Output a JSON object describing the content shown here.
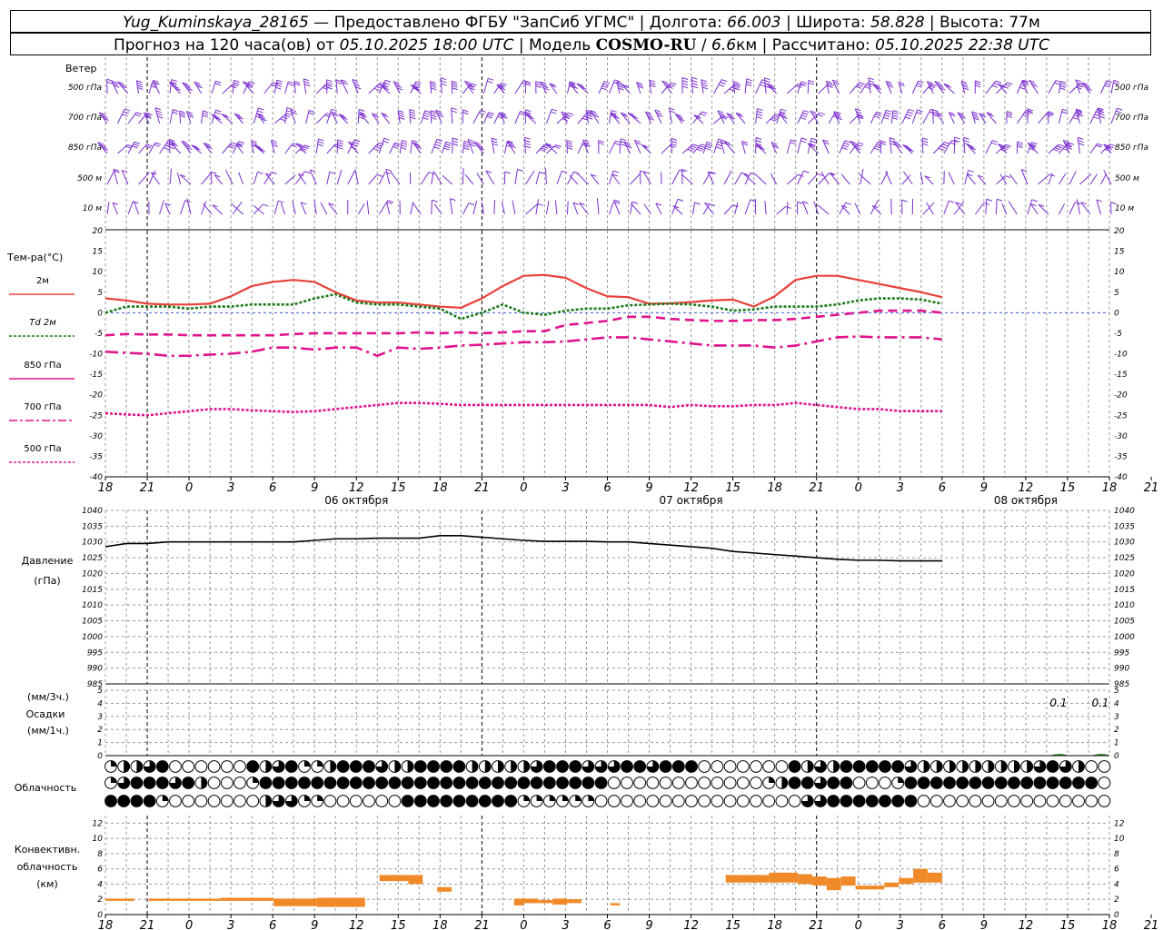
{
  "header": {
    "row1": [
      {
        "t": "Yug_Kuminskaya_28165",
        "italic": true
      },
      {
        "t": " — Предоставлено ФГБУ \"ЗапСиб УГМС\" | Долгота: "
      },
      {
        "t": "66.003",
        "italic": true
      },
      {
        "t": " | Широта: "
      },
      {
        "t": "58.828",
        "italic": true
      },
      {
        "t": " | Высота: "
      },
      {
        "t": "77м",
        "italic": false
      }
    ],
    "row2": [
      {
        "t": "Прогноз на 120 часа(ов) от "
      },
      {
        "t": "05.10.2025 18:00 UTC",
        "italic": true
      },
      {
        "t": "  | Модель "
      },
      {
        "t": "COSMO-RU",
        "bold": true
      },
      {
        "t": " / "
      },
      {
        "t": "6.6",
        "italic": true
      },
      {
        "t": "км | Рассчитано: "
      },
      {
        "t": "05.10.2025 22:38 UTC",
        "italic": true
      }
    ]
  },
  "x_axis": {
    "hour_labels": [
      "18",
      "21",
      "0",
      "3",
      "6",
      "9",
      "12",
      "15",
      "18",
      "21",
      "0",
      "3",
      "6",
      "9",
      "12",
      "15",
      "18",
      "21",
      "0",
      "3",
      "6",
      "9",
      "12",
      "15",
      "18",
      "21",
      "0"
    ],
    "day_labels": [
      "06 октября",
      "07 октября",
      "08 октября"
    ]
  },
  "wind_panel": {
    "title": "Ветер",
    "levels": [
      "500 гПа",
      "700 гПа",
      "850 гПа",
      "500 м",
      "10 м"
    ],
    "color": "#7b2fd0"
  },
  "temp_panel": {
    "title": "Тем-ра(°C)",
    "legend": [
      {
        "label": "2м",
        "color": "#e8403a",
        "dash": "solid"
      },
      {
        "label": "Td 2м",
        "color": "#1a7a1a",
        "dash": "dot"
      },
      {
        "label": "850 гПа",
        "color": "#e0138c",
        "dash": "solid"
      },
      {
        "label": "700 гПа",
        "color": "#e0138c",
        "dash": "dashdot"
      },
      {
        "label": "500 гПа",
        "color": "#e0138c",
        "dash": "dot"
      }
    ],
    "y_ticks": [
      "20",
      "15",
      "10",
      "5",
      "0",
      "-5",
      "-10",
      "-15",
      "-20",
      "-25",
      "-30",
      "-35",
      "-40"
    ]
  },
  "pressure_panel": {
    "title1": "Давление",
    "title2": "(гПа)",
    "y_ticks": [
      "1040",
      "1035",
      "1030",
      "1025",
      "1020",
      "1015",
      "1010",
      "1005",
      "1000",
      "995",
      "990",
      "985"
    ]
  },
  "precip_panel": {
    "title1": "(мм/3ч.)",
    "title2": "Осадки",
    "title3": "(мм/1ч.)",
    "y_ticks": [
      "5",
      "4",
      "3",
      "2",
      "1",
      "0"
    ],
    "annotations": [
      "0.1",
      "0.1"
    ]
  },
  "cloud_panel": {
    "title": "Облачность"
  },
  "conv_panel": {
    "title1": "Конвективн.",
    "title2": "облачность",
    "title3": "(км)",
    "y_ticks": [
      "12",
      "10",
      "8",
      "6",
      "4",
      "2",
      "0"
    ],
    "color": "#f08a28"
  },
  "chart_data": [
    {
      "type": "line",
      "title": "Тем-ра(°C)",
      "x_hours": [
        0,
        3,
        6,
        9,
        12,
        15,
        18,
        21,
        24,
        27,
        30,
        33,
        36,
        39,
        42,
        45,
        48,
        51,
        54,
        57,
        60,
        63,
        66,
        69,
        72,
        75,
        78,
        81,
        84,
        87,
        90,
        93,
        96,
        99,
        102,
        105,
        108,
        111,
        114,
        117,
        120
      ],
      "ylim": [
        -40,
        20
      ],
      "series": [
        {
          "name": "2м",
          "values": [
            3.5,
            3,
            2.2,
            2,
            2,
            2.2,
            4,
            6.5,
            7.5,
            8,
            7.5,
            5,
            3,
            2.5,
            2.5,
            2,
            1.5,
            1.2,
            3.5,
            6.5,
            9,
            9.2,
            8.5,
            6,
            4,
            3.8,
            2.2,
            2.3,
            2.6,
            3,
            3.2,
            1.5,
            4,
            8,
            9,
            9,
            8,
            7,
            6,
            5,
            3.8
          ]
        },
        {
          "name": "Td 2м",
          "values": [
            0,
            1.5,
            1.5,
            1.5,
            1,
            1.5,
            1.5,
            2,
            2,
            2,
            3.5,
            4.5,
            2.5,
            2,
            2,
            1.5,
            1,
            -1.5,
            0,
            2,
            0,
            -0.5,
            0.5,
            1,
            1,
            1.8,
            2,
            2.2,
            2,
            1.5,
            0.5,
            0.8,
            1.5,
            1.5,
            1.5,
            2,
            3,
            3.5,
            3.5,
            3.2,
            2.2
          ]
        },
        {
          "name": "850 гПа",
          "values": [
            -5.5,
            -5.2,
            -5.3,
            -5.3,
            -5.5,
            -5.5,
            -5.5,
            -5.5,
            -5.5,
            -5.2,
            -5,
            -5,
            -5,
            -5,
            -5,
            -4.8,
            -5,
            -4.8,
            -5,
            -4.8,
            -4.5,
            -4.5,
            -3,
            -2.5,
            -2,
            -1,
            -1,
            -1.5,
            -1.8,
            -2,
            -2,
            -1.8,
            -1.8,
            -1.5,
            -1,
            -0.5,
            0,
            0.5,
            0.5,
            0.5,
            0
          ]
        },
        {
          "name": "700 гПа",
          "values": [
            -9.5,
            -9.8,
            -10,
            -10.5,
            -10.5,
            -10.2,
            -10,
            -9.5,
            -8.5,
            -8.5,
            -9,
            -8.5,
            -8.5,
            -10.5,
            -8.5,
            -8.8,
            -8.5,
            -8,
            -7.8,
            -7.5,
            -7.2,
            -7.2,
            -7,
            -6.5,
            -6,
            -6,
            -6.5,
            -7,
            -7.5,
            -8,
            -8,
            -8,
            -8.5,
            -8,
            -7,
            -6,
            -5.8,
            -6,
            -6,
            -6,
            -6.5
          ]
        },
        {
          "name": "500 гПа",
          "values": [
            -24.5,
            -24.8,
            -25,
            -24.5,
            -24,
            -23.5,
            -23.5,
            -23.8,
            -24,
            -24.2,
            -24,
            -23.5,
            -23,
            -22.5,
            -22,
            -22,
            -22.2,
            -22.5,
            -22.5,
            -22.5,
            -22.5,
            -22.5,
            -22.5,
            -22.5,
            -22.5,
            -22.5,
            -22.5,
            -23,
            -22.5,
            -22.8,
            -22.8,
            -22.5,
            -22.5,
            -22,
            -22.5,
            -23,
            -23.5,
            -23.5,
            -24,
            -24,
            -24
          ]
        }
      ]
    },
    {
      "type": "line",
      "title": "Давление",
      "x_hours": [
        0,
        3,
        6,
        9,
        12,
        15,
        18,
        21,
        24,
        27,
        30,
        33,
        36,
        39,
        42,
        45,
        48,
        51,
        54,
        57,
        60,
        63,
        66,
        69,
        72,
        75,
        78,
        81,
        84,
        87,
        90,
        93,
        96,
        99,
        102,
        105,
        108,
        111,
        114,
        117,
        120
      ],
      "ylim": [
        985,
        1040
      ],
      "series": [
        {
          "name": "",
          "values": [
            1028.5,
            1029.5,
            1029.5,
            1030,
            1030,
            1030,
            1030,
            1030,
            1030,
            1030,
            1030.5,
            1031,
            1031,
            1031.2,
            1031.2,
            1031.2,
            1032,
            1032,
            1031.5,
            1031,
            1030.5,
            1030.2,
            1030.2,
            1030.2,
            1030,
            1030,
            1029.5,
            1029,
            1028.5,
            1028,
            1027,
            1026.5,
            1026,
            1025.5,
            1025,
            1024.5,
            1024.2,
            1024.2,
            1024,
            1024,
            1024
          ]
        }
      ]
    },
    {
      "type": "bar",
      "title": "Осадки",
      "ylim": [
        0,
        5
      ],
      "x_hours": [
        114,
        120
      ],
      "values": [
        0.1,
        0.1
      ]
    },
    {
      "type": "bar",
      "title": "Конвективн. облачность (км)",
      "ylim": [
        0,
        13
      ],
      "segments": [
        {
          "h0": 0,
          "h1": 6,
          "lo": 1.8,
          "hi": 2.1
        },
        {
          "h0": 9,
          "h1": 24,
          "lo": 1.8,
          "hi": 2.1
        },
        {
          "h0": 24,
          "h1": 35,
          "lo": 1.8,
          "hi": 2.2
        },
        {
          "h0": 35,
          "h1": 44,
          "lo": 1.1,
          "hi": 2.1
        },
        {
          "h0": 44,
          "h1": 54,
          "lo": 1.0,
          "hi": 2.2
        },
        {
          "h0": 57,
          "h1": 63,
          "lo": 4.4,
          "hi": 5.2
        },
        {
          "h0": 63,
          "h1": 66,
          "lo": 4.0,
          "hi": 5.2
        },
        {
          "h0": 69,
          "h1": 72,
          "lo": 3.0,
          "hi": 3.6
        },
        {
          "h0": 85,
          "h1": 87,
          "lo": 1.2,
          "hi": 2.1
        },
        {
          "h0": 87,
          "h1": 90,
          "lo": 1.5,
          "hi": 2.1
        },
        {
          "h0": 90,
          "h1": 93,
          "lo": 1.5,
          "hi": 1.9
        },
        {
          "h0": 93,
          "h1": 96,
          "lo": 1.3,
          "hi": 2.1
        },
        {
          "h0": 96,
          "h1": 99,
          "lo": 1.5,
          "hi": 2.0
        },
        {
          "h0": 105,
          "h1": 107,
          "lo": 1.2,
          "hi": 1.5
        },
        {
          "h0": 129,
          "h1": 132,
          "lo": 4.2,
          "hi": 5.2
        },
        {
          "h0": 132,
          "h1": 138,
          "lo": 4.2,
          "hi": 5.2
        },
        {
          "h0": 138,
          "h1": 144,
          "lo": 4.2,
          "hi": 5.5
        },
        {
          "h0": 144,
          "h1": 147,
          "lo": 4.0,
          "hi": 5.3
        },
        {
          "h0": 147,
          "h1": 150,
          "lo": 3.8,
          "hi": 5.0
        },
        {
          "h0": 150,
          "h1": 153,
          "lo": 3.2,
          "hi": 4.8
        },
        {
          "h0": 153,
          "h1": 156,
          "lo": 3.8,
          "hi": 5.0
        },
        {
          "h0": 156,
          "h1": 159,
          "lo": 3.3,
          "hi": 3.8
        },
        {
          "h0": 159,
          "h1": 162,
          "lo": 3.3,
          "hi": 3.8
        },
        {
          "h0": 162,
          "h1": 165,
          "lo": 3.6,
          "hi": 4.2
        },
        {
          "h0": 165,
          "h1": 168,
          "lo": 4.0,
          "hi": 4.8
        },
        {
          "h0": 168,
          "h1": 171,
          "lo": 4.2,
          "hi": 6.0
        },
        {
          "h0": 171,
          "h1": 174,
          "lo": 4.2,
          "hi": 5.5
        }
      ]
    },
    {
      "type": "table",
      "title": "Облачность",
      "rows": [
        "abbcd000000dbcdaabdddcbbddddbbbbbcdddcccddcddd0000000dbcbdddddcbbbbbbbbbcdcb00",
        "acdddcdb000addddddddddddddddddddddddddd000000000000abddcdd000addddddddddddddd",
        "dddda0000000bccaa000000dddddddddaaaaaa0000000000000000ccddddddd0000000000000000"
      ]
    }
  ]
}
